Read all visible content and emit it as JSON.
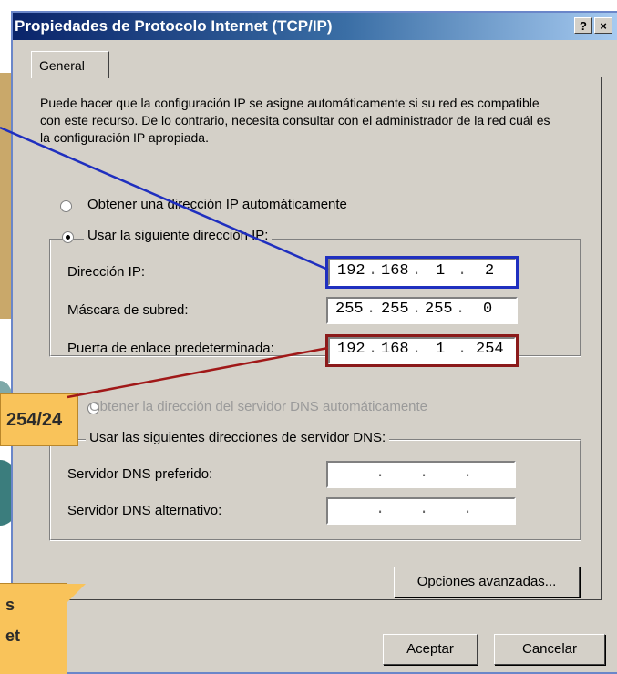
{
  "window": {
    "title": "Propiedades de Protocolo Internet (TCP/IP)",
    "help_glyph": "?",
    "close_glyph": "×"
  },
  "tabs": [
    {
      "label": "General"
    }
  ],
  "description": "Puede hacer que la configuración IP se asigne automáticamente si su red es compatible con este recurso. De lo contrario, necesita consultar con el administrador de la red cuál es la configuración IP apropiada.",
  "ip_mode": {
    "auto_label": "Obtener una dirección IP automáticamente",
    "manual_label": "Usar la siguiente dirección IP:",
    "selected": "manual"
  },
  "ip_fields": {
    "address": {
      "label": "Dirección IP:",
      "octets": [
        "192",
        "168",
        "1",
        "2"
      ]
    },
    "mask": {
      "label": "Máscara de subred:",
      "octets": [
        "255",
        "255",
        "255",
        "0"
      ]
    },
    "gateway": {
      "label": "Puerta de enlace predeterminada:",
      "octets": [
        "192",
        "168",
        "1",
        "254"
      ]
    }
  },
  "dns_mode": {
    "auto_label": "Obtener la dirección del servidor DNS automáticamente",
    "manual_label": "Usar las siguientes direcciones de servidor DNS:",
    "selected": "manual"
  },
  "dns_fields": {
    "preferred": {
      "label": "Servidor DNS preferido:"
    },
    "alternate": {
      "label": "Servidor DNS alternativo:"
    }
  },
  "buttons": {
    "advanced": "Opciones avanzadas...",
    "ok": "Aceptar",
    "cancel": "Cancelar"
  },
  "overlay": {
    "callout_top": "254/24",
    "callout_bottom_line1": "s",
    "callout_bottom_line2": "et"
  },
  "colors": {
    "highlight_blue": "#1f2fbf",
    "highlight_red": "#8b1a1a",
    "callout_orange": "#f9c35a"
  }
}
